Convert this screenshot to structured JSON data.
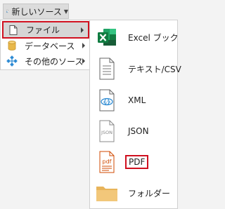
{
  "toolbar": {
    "new_source_label": "新しいソース"
  },
  "menu_level1": {
    "items": [
      {
        "label": "ファイル",
        "icon": "file-icon",
        "selected": true
      },
      {
        "label": "データベース",
        "icon": "database-icon"
      },
      {
        "label": "その他のソース",
        "icon": "network-icon"
      }
    ]
  },
  "menu_level2": {
    "items": [
      {
        "label": "Excel ブック",
        "icon": "excel-icon"
      },
      {
        "label": "テキスト/CSV",
        "icon": "text-file-icon"
      },
      {
        "label": "XML",
        "icon": "xml-file-icon"
      },
      {
        "label": "JSON",
        "icon": "json-file-icon",
        "icon_text": "JSON"
      },
      {
        "label": "PDF",
        "icon": "pdf-file-icon",
        "icon_text": "pdf",
        "highlighted": true
      },
      {
        "label": "フォルダー",
        "icon": "folder-icon"
      }
    ]
  },
  "colors": {
    "highlight_border": "#d0101f",
    "excel_green": "#1e7145",
    "pdf_red": "#d04a02",
    "folder_yellow": "#f2c77a",
    "network_blue": "#2e8bd3",
    "database_yellow": "#e8b84a"
  }
}
